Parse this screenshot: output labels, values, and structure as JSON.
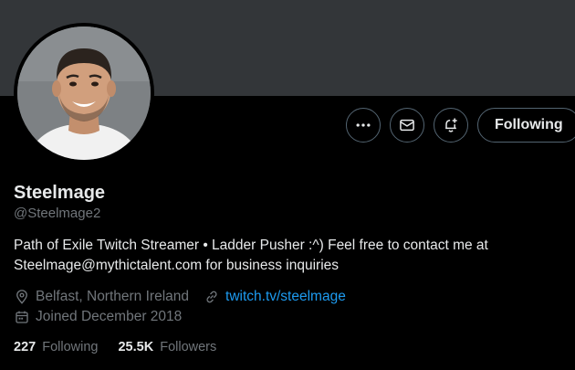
{
  "profile": {
    "display_name": "Steelmage",
    "handle": "@Steelmage2",
    "bio_line1": "Path of Exile Twitch Streamer • Ladder Pusher :^) Feel free to contact me at",
    "bio_line2": "Steelmage@mythictalent.com for business inquiries",
    "location": "Belfast, Northern Ireland",
    "website": "twitch.tv/steelmage",
    "joined": "Joined December 2018"
  },
  "actions": {
    "more_icon": "more-icon",
    "message_icon": "envelope-icon",
    "notify_icon": "bell-plus-icon",
    "follow_label": "Following"
  },
  "stats": {
    "following_count": "227",
    "following_label": "Following",
    "followers_count": "25.5K",
    "followers_label": "Followers"
  },
  "colors": {
    "background": "#000000",
    "banner": "#333639",
    "accent": "#1d9bf0",
    "muted": "#71767b",
    "text": "#e7e9ea"
  }
}
